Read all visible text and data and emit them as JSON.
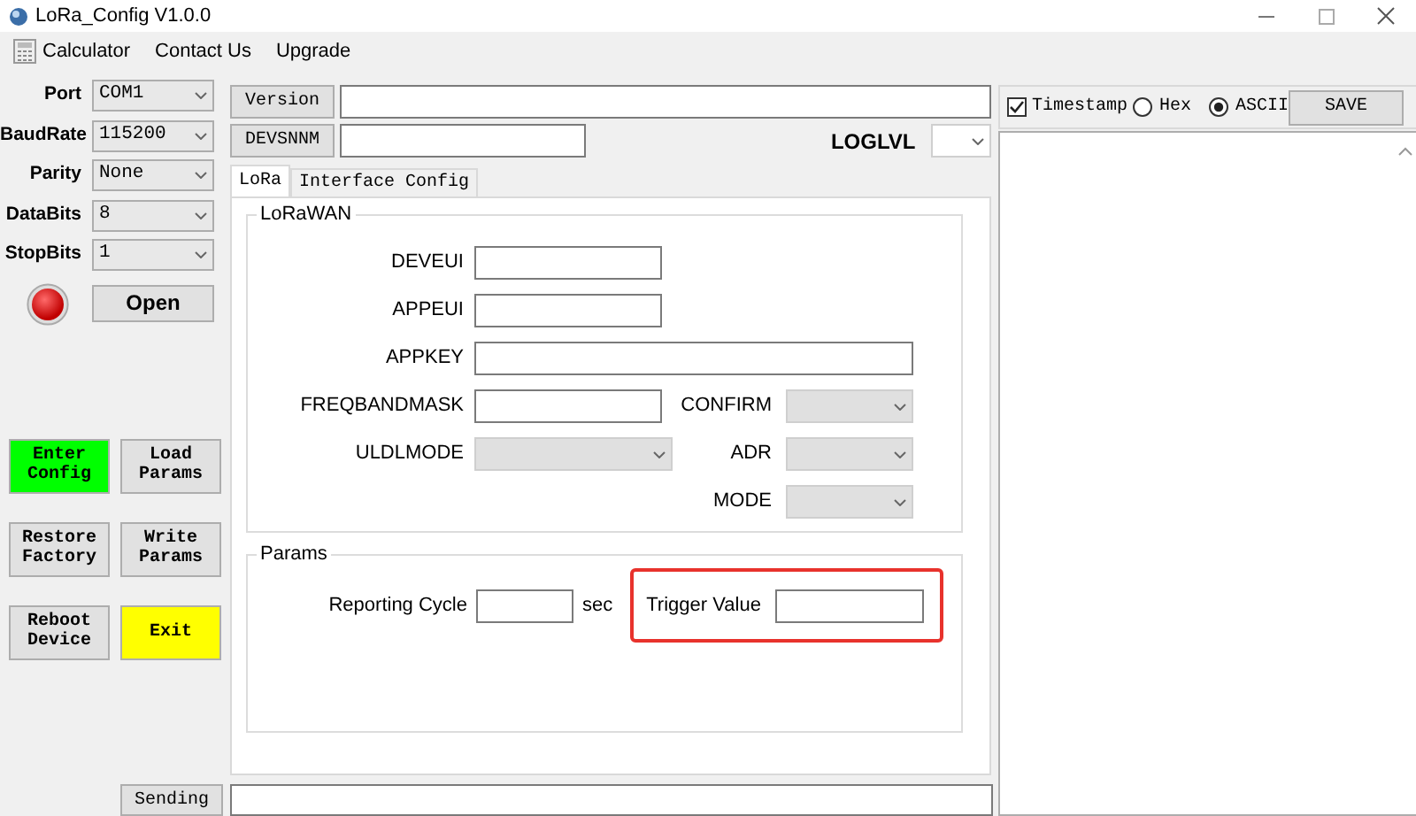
{
  "window": {
    "title": "LoRa_Config V1.0.0"
  },
  "menu": [
    {
      "label": "Calculator",
      "kind": "with-icon"
    },
    {
      "label": "Contact Us",
      "kind": "plain"
    },
    {
      "label": "Upgrade",
      "kind": "plain"
    }
  ],
  "serial": {
    "fields": [
      {
        "label": "Port",
        "value": "COM1"
      },
      {
        "label": "BaudRate",
        "value": "115200"
      },
      {
        "label": "Parity",
        "value": "None"
      },
      {
        "label": "DataBits",
        "value": "8"
      },
      {
        "label": "StopBits",
        "value": "1"
      }
    ],
    "port_open": false,
    "open_button": "Open"
  },
  "actions": [
    {
      "label": "Enter Config",
      "color": "#00ff00"
    },
    {
      "label": "Load Params"
    },
    {
      "label": "Restore Factory"
    },
    {
      "label": "Write Params"
    },
    {
      "label": "Reboot Device"
    },
    {
      "label": "Exit",
      "color": "#ffff00"
    }
  ],
  "sending_button": "Sending",
  "info": {
    "version_button": "Version",
    "devsn_button": "DEVSNNM",
    "loglvl_label": "LOGLVL"
  },
  "tabs": [
    {
      "label": "LoRa",
      "selected": true
    },
    {
      "label": "Interface Config",
      "selected": false
    }
  ],
  "lorawan": {
    "title": "LoRaWAN",
    "rows": [
      {
        "left": {
          "label": "DEVEUI",
          "kind": "text-short"
        }
      },
      {
        "left": {
          "label": "APPEUI",
          "kind": "text-short"
        }
      },
      {
        "left": {
          "label": "APPKEY",
          "kind": "text-long"
        }
      },
      {
        "left": {
          "label": "FREQBANDMASK",
          "kind": "text-short"
        },
        "right": {
          "label": "CONFIRM",
          "kind": "select",
          "disabled": true
        }
      },
      {
        "left": {
          "label": "ULDLMODE",
          "kind": "select",
          "disabled": true
        },
        "right": {
          "label": "ADR",
          "kind": "select",
          "disabled": true
        }
      },
      {
        "right": {
          "label": "MODE",
          "kind": "select",
          "disabled": true
        }
      }
    ]
  },
  "params": {
    "title": "Params",
    "reporting_label": "Reporting Cycle",
    "unit": "sec",
    "trigger_label": "Trigger Value",
    "trigger_highlighted": true
  },
  "log": {
    "timestamp": {
      "label": "Timestamp",
      "checked": true
    },
    "formats": [
      {
        "label": "Hex",
        "selected": false
      },
      {
        "label": "ASCII",
        "selected": true
      }
    ],
    "save_button": "SAVE"
  }
}
